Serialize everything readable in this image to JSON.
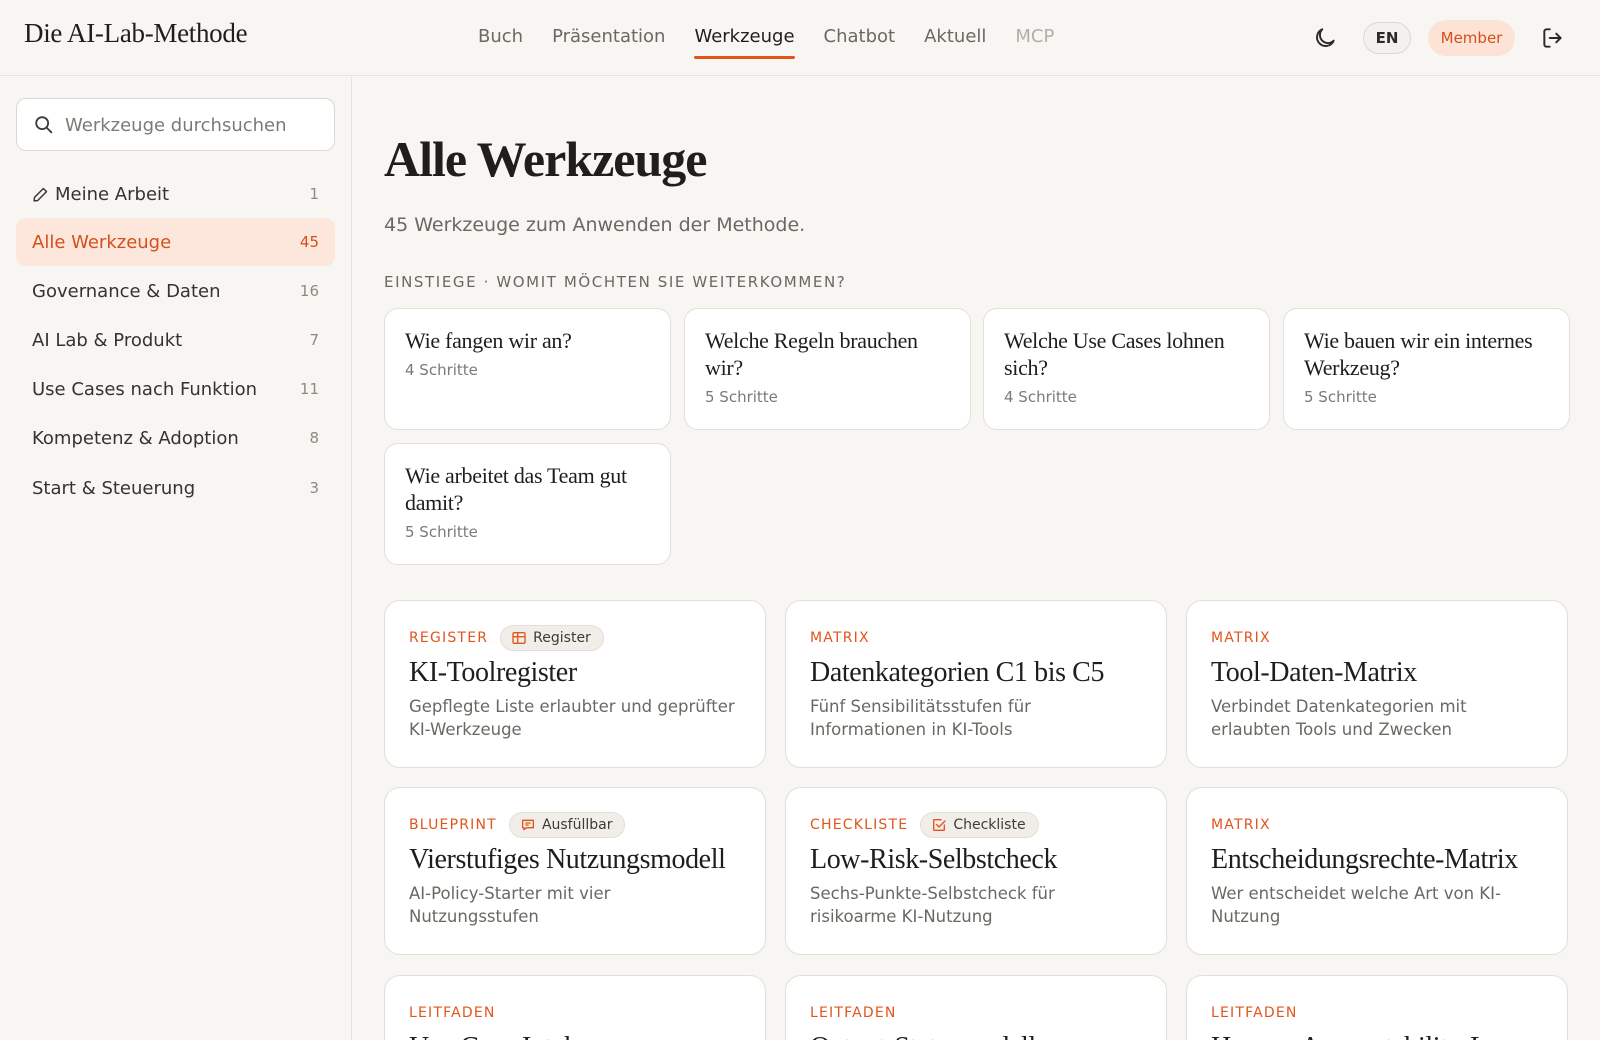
{
  "header": {
    "logo": "Die AI-Lab-Methode",
    "nav": [
      {
        "label": "Buch",
        "state": "default"
      },
      {
        "label": "Präsentation",
        "state": "default"
      },
      {
        "label": "Werkzeuge",
        "state": "active"
      },
      {
        "label": "Chatbot",
        "state": "default"
      },
      {
        "label": "Aktuell",
        "state": "default"
      },
      {
        "label": "MCP",
        "state": "muted"
      }
    ],
    "theme_icon": "moon-icon",
    "lang_label": "EN",
    "member_label": "Member",
    "logout_icon": "logout-icon"
  },
  "sidebar": {
    "search_placeholder": "Werkzeuge durchsuchen",
    "items": [
      {
        "label": "Meine Arbeit",
        "count": "1",
        "icon": "pencil-icon"
      },
      {
        "label": "Alle Werkzeuge",
        "count": "45",
        "active": true
      },
      {
        "label": "Governance & Daten",
        "count": "16"
      },
      {
        "label": "AI Lab & Produkt",
        "count": "7"
      },
      {
        "label": "Use Cases nach Funktion",
        "count": "11"
      },
      {
        "label": "Kompetenz & Adoption",
        "count": "8"
      },
      {
        "label": "Start & Steuerung",
        "count": "3"
      }
    ]
  },
  "main": {
    "title": "Alle Werkzeuge",
    "subtitle": "45 Werkzeuge zum Anwenden der Methode.",
    "entries_label": "EINSTIEGE · WOMIT MÖCHTEN SIE WEITERKOMMEN?",
    "entries": [
      {
        "question": "Wie fangen wir an?",
        "steps": "4 Schritte"
      },
      {
        "question": "Welche Regeln brauchen wir?",
        "steps": "5 Schritte"
      },
      {
        "question": "Welche Use Cases lohnen sich?",
        "steps": "4 Schritte"
      },
      {
        "question": "Wie bauen wir ein internes Werkzeug?",
        "steps": "5 Schritte"
      },
      {
        "question": "Wie arbeitet das Team gut damit?",
        "steps": "5 Schritte"
      }
    ],
    "tools": [
      {
        "kind": "REGISTER",
        "tag": "Register",
        "tag_icon": "table-icon",
        "title": "KI-Toolregister",
        "desc": "Gepflegte Liste erlaubter und geprüfter KI-Werkzeuge"
      },
      {
        "kind": "MATRIX",
        "title": "Datenkategorien C1 bis C5",
        "desc": "Fünf Sensibilitätsstufen für Informationen in KI-Tools"
      },
      {
        "kind": "MATRIX",
        "title": "Tool-Daten-Matrix",
        "desc": "Verbindet Datenkategorien mit erlaubten Tools und Zwecken"
      },
      {
        "kind": "BLUEPRINT",
        "tag": "Ausfüllbar",
        "tag_icon": "form-icon",
        "title": "Vierstufiges Nutzungsmodell",
        "desc": "AI-Policy-Starter mit vier Nutzungsstufen"
      },
      {
        "kind": "CHECKLISTE",
        "tag": "Checkliste",
        "tag_icon": "checkbox-icon",
        "title": "Low-Risk-Selbstcheck",
        "desc": "Sechs-Punkte-Selbstcheck für risikoarme KI-Nutzung"
      },
      {
        "kind": "MATRIX",
        "title": "Entscheidungsrechte-Matrix",
        "desc": "Wer entscheidet welche Art von KI-Nutzung"
      },
      {
        "kind": "LEITFADEN",
        "title": "Use-Case-Intake",
        "desc": ""
      },
      {
        "kind": "LEITFADEN",
        "title": "Output-Statusmodell",
        "desc": ""
      },
      {
        "kind": "LEITFADEN",
        "title": "Human-Accountability-Loop",
        "desc": ""
      }
    ]
  },
  "colors": {
    "accent": "#e2551c",
    "accent_bg": "#fde7dc",
    "background": "#f7f6f3",
    "card": "#ffffff"
  }
}
